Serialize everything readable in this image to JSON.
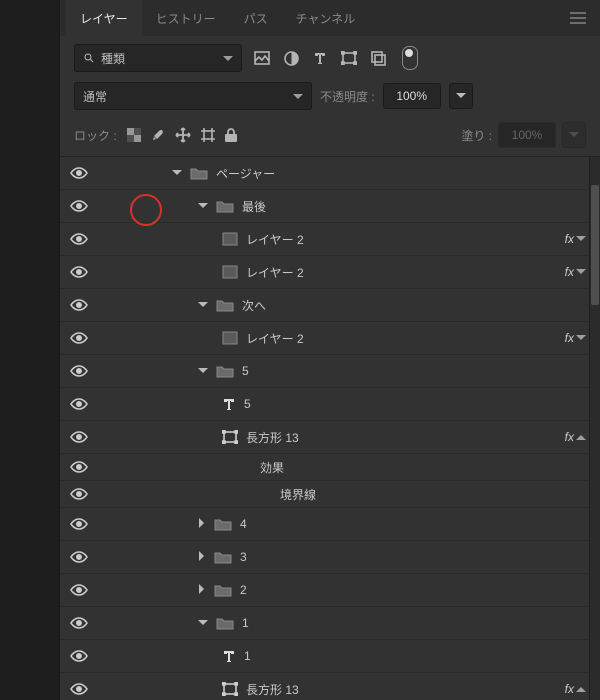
{
  "tabs": {
    "layers": "レイヤー",
    "history": "ヒストリー",
    "paths": "パス",
    "channels": "チャンネル"
  },
  "filter": {
    "search_icon": "search",
    "kind_label": "種類",
    "icons": [
      "image",
      "adjust",
      "type",
      "shape",
      "smart"
    ]
  },
  "blend": {
    "mode": "通常",
    "opacity_label": "不透明度 :",
    "opacity_value": "100%"
  },
  "lock": {
    "label": "ロック :",
    "fill_label": "塗り :",
    "fill_value": "100%"
  },
  "layers": [
    {
      "indent": 0,
      "kind": "groupOpen",
      "name": "ページャー",
      "vis": true
    },
    {
      "indent": 1,
      "kind": "groupOpen",
      "name": "最後",
      "vis": true
    },
    {
      "indent": 2,
      "kind": "smart",
      "name": "レイヤー 2",
      "vis": true,
      "fx": true,
      "open": false
    },
    {
      "indent": 2,
      "kind": "smart",
      "name": "レイヤー 2",
      "vis": true,
      "fx": true,
      "open": false
    },
    {
      "indent": 1,
      "kind": "groupOpen",
      "name": "次へ",
      "vis": true
    },
    {
      "indent": 2,
      "kind": "smart",
      "name": "レイヤー 2",
      "vis": true,
      "fx": true,
      "open": false
    },
    {
      "indent": 1,
      "kind": "groupOpen",
      "name": "5",
      "vis": true
    },
    {
      "indent": 2,
      "kind": "type",
      "name": "5",
      "vis": true
    },
    {
      "indent": 2,
      "kind": "shape",
      "name": "長方形 13",
      "vis": true,
      "fx": true,
      "open": true
    },
    {
      "indent": 4,
      "kind": "fxhead",
      "name": "効果"
    },
    {
      "indent": 5,
      "kind": "fxitem",
      "name": "境界線"
    },
    {
      "indent": 1,
      "kind": "groupClosed",
      "name": "4",
      "vis": true
    },
    {
      "indent": 1,
      "kind": "groupClosed",
      "name": "3",
      "vis": true
    },
    {
      "indent": 1,
      "kind": "groupClosed",
      "name": "2",
      "vis": true
    },
    {
      "indent": 1,
      "kind": "groupOpen",
      "name": "1",
      "vis": true
    },
    {
      "indent": 2,
      "kind": "type",
      "name": "1",
      "vis": true
    },
    {
      "indent": 2,
      "kind": "shape",
      "name": "長方形 13",
      "vis": true,
      "fx": true,
      "open": true
    }
  ]
}
